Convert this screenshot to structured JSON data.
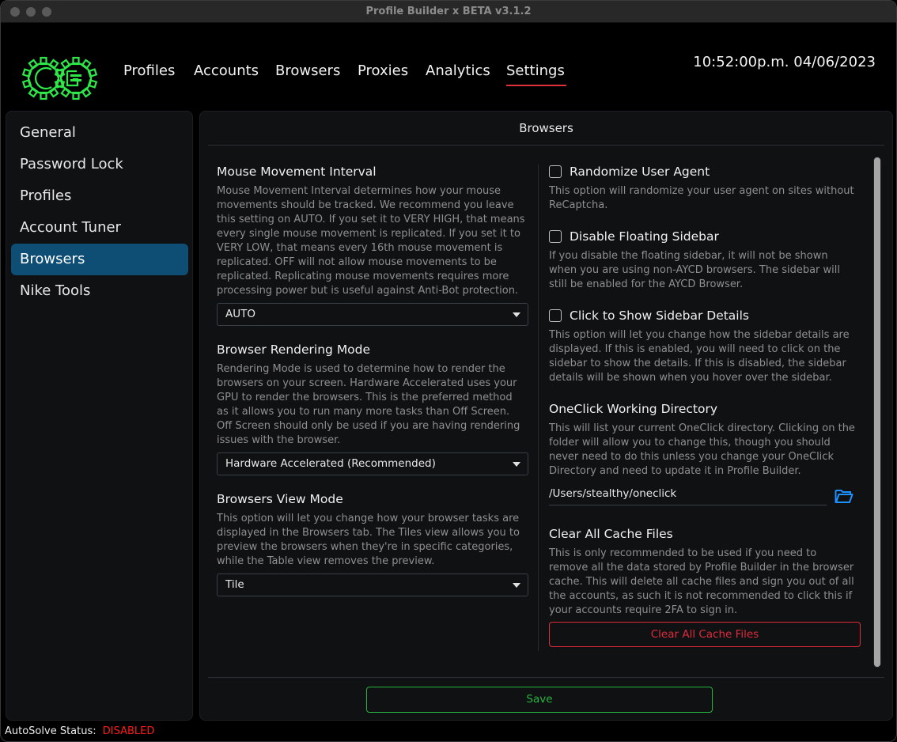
{
  "window": {
    "title": "Profile Builder x BETA v3.1.2"
  },
  "header": {
    "nav": [
      "Profiles",
      "Accounts",
      "Browsers",
      "Proxies",
      "Analytics",
      "Settings"
    ],
    "active_nav": "Settings",
    "clock": "10:52:00p.m. 04/06/2023"
  },
  "sidebar": {
    "items": [
      "General",
      "Password Lock",
      "Profiles",
      "Account Tuner",
      "Browsers",
      "Nike Tools"
    ],
    "active": "Browsers"
  },
  "panel": {
    "title": "Browsers",
    "left": {
      "mouse": {
        "title": "Mouse Movement Interval",
        "desc_lines": [
          "Mouse Movement Interval determines how your mouse",
          "movements should be tracked. We recommend you leave",
          "this setting on AUTO. If you set it to VERY HIGH, that means",
          "every single mouse movement is replicated. If you set it to",
          "VERY LOW, that means every 16th mouse movement is",
          "replicated. OFF will not allow mouse movements to be",
          "replicated. Replicating mouse movements requires more",
          "processing power but is useful against Anti-Bot protection."
        ],
        "value": "AUTO"
      },
      "rendering": {
        "title": "Browser Rendering Mode",
        "desc_lines": [
          "Rendering Mode is used to determine how to render the",
          "browsers on your screen. Hardware Accelerated uses your",
          "GPU to render the browsers. This is the preferred method",
          "as it allows you to run many more tasks than Off Screen.",
          "Off Screen should only be used if you are having rendering",
          "issues with the browser."
        ],
        "value": "Hardware Accelerated (Recommended)"
      },
      "view": {
        "title": "Browsers View Mode",
        "desc_lines": [
          "This option will let you change how your browser tasks are",
          "displayed in the Browsers tab. The Tiles view allows you to",
          "preview the browsers when they're in specific categories,",
          "while the Table view removes the preview."
        ],
        "value": "Tile"
      }
    },
    "right": {
      "randomize": {
        "label": "Randomize User Agent",
        "checked": false,
        "desc_lines": [
          "This option will randomize your user agent on sites without",
          "ReCaptcha."
        ]
      },
      "floating": {
        "label": "Disable Floating Sidebar",
        "checked": false,
        "desc_lines": [
          "If you disable the floating sidebar, it will not be shown",
          "when you are using non-AYCD browsers. The sidebar will",
          "still be enabled for the AYCD Browser."
        ]
      },
      "details": {
        "label": "Click to Show Sidebar Details",
        "checked": false,
        "desc_lines": [
          "This option will let you change how the sidebar details are",
          "displayed. If this is enabled, you will need to click on the",
          "sidebar to show the details. If this is disabled, the sidebar",
          "details will be shown when you hover over the sidebar."
        ]
      },
      "oneclick": {
        "title": "OneClick Working Directory",
        "desc_lines": [
          "This will list your current OneClick directory. Clicking on the",
          "folder will allow you to change this, though you should",
          "never need to do this unless you change your OneClick",
          "Directory and need to update it in Profile Builder."
        ],
        "path": "/Users/stealthy/oneclick"
      },
      "cache": {
        "title": "Clear All Cache Files",
        "desc_lines": [
          "This is only recommended to be used if you need to",
          "remove all the data stored by Profile Builder in the browser",
          "cache. This will delete all cache files and sign you out of all",
          "the accounts, as such it is not recommended to click this if",
          "your accounts require 2FA to sign in."
        ],
        "button": "Clear All Cache Files"
      }
    },
    "save": "Save"
  },
  "status": {
    "label": "AutoSolve Status:",
    "value": "DISABLED"
  },
  "colors": {
    "accent_red": "#e0303a",
    "active_blue": "#0e4e75",
    "save_green": "#27b33f",
    "logo_green": "#2ee84a",
    "folder_blue": "#1e90ff"
  }
}
